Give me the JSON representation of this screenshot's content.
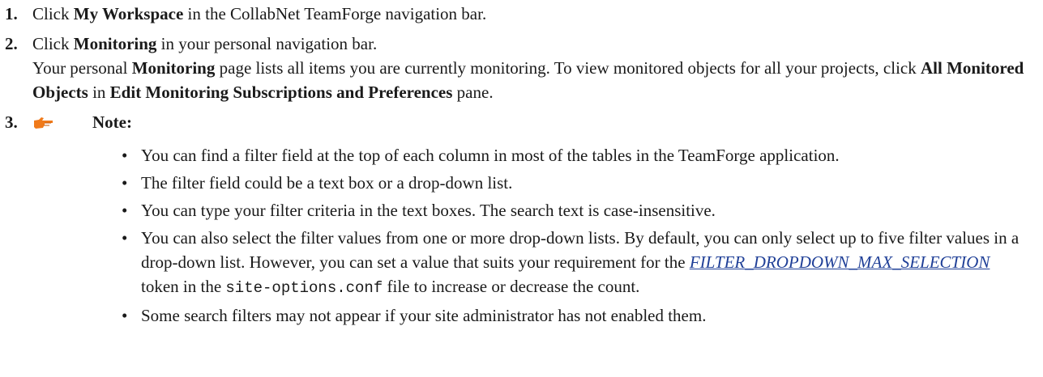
{
  "steps": [
    {
      "number": "1.",
      "pre": "Click ",
      "bold": "My Workspace",
      "post": " in the CollabNet TeamForge navigation bar."
    },
    {
      "number": "2.",
      "pre": "Click ",
      "bold": "Monitoring",
      "post": " in your personal navigation bar.",
      "detail": {
        "a": "Your personal ",
        "b": "Monitoring",
        "c": " page lists all items you are currently monitoring. To view monitored objects for all your projects, click ",
        "d": "All Monitored Objects",
        "e": " in ",
        "f": "Edit Monitoring Subscriptions and Preferences",
        "g": " pane."
      }
    },
    {
      "number": "3.",
      "note_label": "Note:"
    }
  ],
  "note_items": [
    {
      "text": "You can find a filter field at the top of each column in most of the tables in the TeamForge application."
    },
    {
      "text": "The filter field could be a text box or a drop-down list."
    },
    {
      "text": "You can type your filter criteria in the text boxes. The search text is case-insensitive."
    },
    {
      "pre": "You can also select the filter values from one or more drop-down lists. By default, you can only select up to five filter values in a drop-down list. However, you can set a value that suits your requirement for the ",
      "token": "FILTER_DROPDOWN_MAX_SELECTION",
      "mid": " token in the ",
      "file": "site-options.conf",
      "post": " file to increase or decrease the count."
    },
    {
      "text": "Some search filters may not appear if your site administrator has not enabled them."
    }
  ],
  "icons": {
    "note": "pointing-hand-icon",
    "note_color": "#f07a1a"
  }
}
